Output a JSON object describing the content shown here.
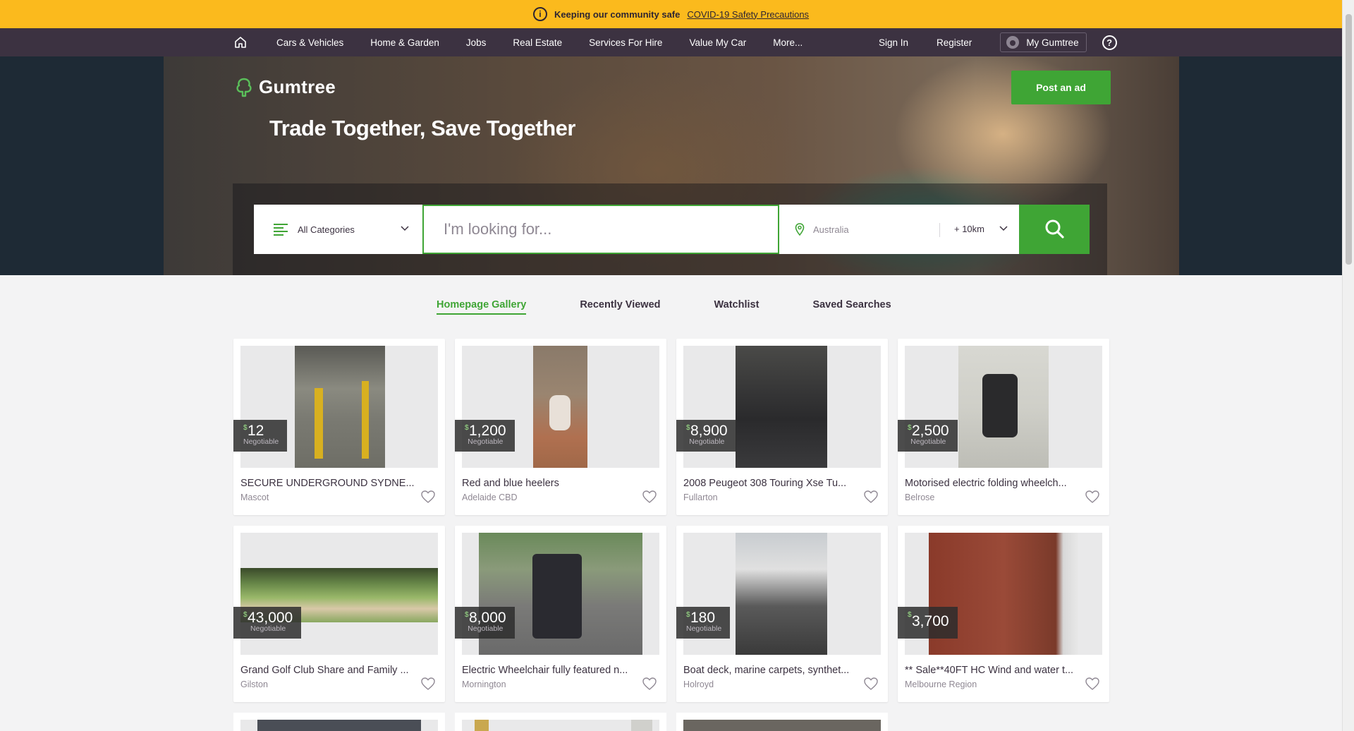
{
  "banner": {
    "bold": "Keeping our community safe",
    "link": "COVID-19 Safety Precautions"
  },
  "nav": {
    "items": [
      "Cars & Vehicles",
      "Home & Garden",
      "Jobs",
      "Real Estate",
      "Services For Hire",
      "Value My Car",
      "More..."
    ],
    "sign_in": "Sign In",
    "register": "Register",
    "my_gumtree": "My Gumtree"
  },
  "hero": {
    "logo": "Gumtree",
    "tagline": "Trade Together, Save Together",
    "post_ad": "Post an ad"
  },
  "search": {
    "category": "All Categories",
    "placeholder": "I'm looking for...",
    "location": "Australia",
    "radius": "+ 10km"
  },
  "tabs": [
    "Homepage Gallery",
    "Recently Viewed",
    "Watchlist",
    "Saved Searches"
  ],
  "listings": [
    {
      "price": "12",
      "negotiable": "Negotiable",
      "title": "SECURE UNDERGROUND SYDNE...",
      "location": "Mascot"
    },
    {
      "price": "1,200",
      "negotiable": "Negotiable",
      "title": "Red and blue heelers",
      "location": "Adelaide CBD"
    },
    {
      "price": "8,900",
      "negotiable": "Negotiable",
      "title": "2008 Peugeot 308 Touring Xse Tu...",
      "location": "Fullarton"
    },
    {
      "price": "2,500",
      "negotiable": "Negotiable",
      "title": "Motorised electric folding wheelch...",
      "location": "Belrose"
    },
    {
      "price": "43,000",
      "negotiable": "Negotiable",
      "title": "Grand Golf Club Share and Family ...",
      "location": "Gilston"
    },
    {
      "price": "8,000",
      "negotiable": "Negotiable",
      "title": "Electric Wheelchair fully featured n...",
      "location": "Mornington"
    },
    {
      "price": "180",
      "negotiable": "Negotiable",
      "title": "Boat deck, marine carpets, synthet...",
      "location": "Holroyd"
    },
    {
      "price": "3,700",
      "negotiable": "",
      "title": "** Sale**40FT HC Wind and water t...",
      "location": "Melbourne Region"
    }
  ],
  "colors": {
    "brand_green": "#3fa535",
    "nav_bg": "#3c3241",
    "banner_bg": "#fbba1d"
  }
}
